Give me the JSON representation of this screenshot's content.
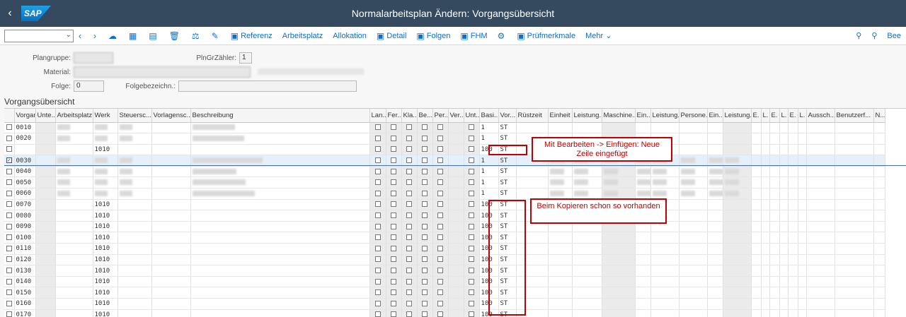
{
  "shell": {
    "back": "‹",
    "logo": "SAP",
    "title": "Normalarbeitsplan Ändern: Vorgangsübersicht"
  },
  "toolbar": {
    "items": [
      {
        "icon": "‹",
        "label": ""
      },
      {
        "icon": "›",
        "label": ""
      },
      {
        "icon": "☁",
        "label": ""
      },
      {
        "icon": "▦",
        "label": ""
      },
      {
        "icon": "▤",
        "label": ""
      },
      {
        "icon": "🗑",
        "label": ""
      },
      {
        "icon": "⚖",
        "label": ""
      },
      {
        "icon": "✎",
        "label": ""
      },
      {
        "icon": "▣",
        "label": "Referenz"
      },
      {
        "icon": "",
        "label": "Arbeitsplatz"
      },
      {
        "icon": "",
        "label": "Allokation"
      },
      {
        "icon": "▣",
        "label": "Detail"
      },
      {
        "icon": "▣",
        "label": "Folgen"
      },
      {
        "icon": "▣",
        "label": "FHM"
      },
      {
        "icon": "⚙",
        "label": ""
      },
      {
        "icon": "▣",
        "label": "Prüfmerkmale"
      },
      {
        "icon": "",
        "label": "Mehr ⌄"
      }
    ],
    "right": {
      "search": "⚲",
      "zoom": "⚲",
      "edit": "Bee"
    }
  },
  "header": {
    "plangruppe_label": "Plangruppe:",
    "plngrzaehler_label": "PlnGrZähler:",
    "plngrzaehler_value": "1",
    "material_label": "Material:",
    "folge_label": "Folge:",
    "folge_value": "0",
    "folgebez_label": "Folgebezeichn.:"
  },
  "section_title": "Vorgangsübersicht",
  "columns": [
    "",
    "Vorgang",
    "Unte...",
    "Arbeitsplatz",
    "Werk",
    "Steuersc...",
    "Vorlagensc...",
    "Beschreibung",
    "Lan...",
    "Fer...",
    "Kla...",
    "Be...",
    "Per...",
    "Ver...",
    "Unt...",
    "Basi...",
    "Vor...",
    "Rüstzeit",
    "Einheit",
    "Leistung...",
    "Maschine...",
    "Ein...",
    "Leistung...",
    "Persone...",
    "Ein...",
    "Leistung...",
    "E.",
    "L.",
    "E.",
    "L.",
    "E.",
    "L.",
    "Aussch...",
    "Benutzerf...",
    "N..."
  ],
  "rows": [
    {
      "vorgang": "0010",
      "werk": "",
      "basis": "1",
      "einheit": "ST",
      "checked": false,
      "blurred": true
    },
    {
      "vorgang": "0020",
      "werk": "",
      "basis": "1",
      "einheit": "ST",
      "checked": false,
      "blurred": true
    },
    {
      "vorgang": "",
      "werk": "1010",
      "basis": "100",
      "einheit": "ST",
      "checked": false,
      "blurred": false
    },
    {
      "vorgang": "0030",
      "werk": "",
      "basis": "1",
      "einheit": "ST",
      "checked": true,
      "blurred": true
    },
    {
      "vorgang": "0040",
      "werk": "",
      "basis": "1",
      "einheit": "ST",
      "checked": false,
      "blurred": true
    },
    {
      "vorgang": "0050",
      "werk": "",
      "basis": "1",
      "einheit": "ST",
      "checked": false,
      "blurred": true
    },
    {
      "vorgang": "0060",
      "werk": "",
      "basis": "1",
      "einheit": "ST",
      "checked": false,
      "blurred": true
    },
    {
      "vorgang": "0070",
      "werk": "1010",
      "basis": "100",
      "einheit": "ST",
      "checked": false,
      "blurred": false
    },
    {
      "vorgang": "0080",
      "werk": "1010",
      "basis": "100",
      "einheit": "ST",
      "checked": false,
      "blurred": false
    },
    {
      "vorgang": "0090",
      "werk": "1010",
      "basis": "100",
      "einheit": "ST",
      "checked": false,
      "blurred": false
    },
    {
      "vorgang": "0100",
      "werk": "1010",
      "basis": "100",
      "einheit": "ST",
      "checked": false,
      "blurred": false
    },
    {
      "vorgang": "0110",
      "werk": "1010",
      "basis": "100",
      "einheit": "ST",
      "checked": false,
      "blurred": false
    },
    {
      "vorgang": "0120",
      "werk": "1010",
      "basis": "100",
      "einheit": "ST",
      "checked": false,
      "blurred": false
    },
    {
      "vorgang": "0130",
      "werk": "1010",
      "basis": "100",
      "einheit": "ST",
      "checked": false,
      "blurred": false
    },
    {
      "vorgang": "0140",
      "werk": "1010",
      "basis": "100",
      "einheit": "ST",
      "checked": false,
      "blurred": false
    },
    {
      "vorgang": "0150",
      "werk": "1010",
      "basis": "100",
      "einheit": "ST",
      "checked": false,
      "blurred": false
    },
    {
      "vorgang": "0160",
      "werk": "1010",
      "basis": "100",
      "einheit": "ST",
      "checked": false,
      "blurred": false
    },
    {
      "vorgang": "0170",
      "werk": "1010",
      "basis": "100",
      "einheit": "ST",
      "checked": false,
      "blurred": false
    }
  ],
  "annotations": {
    "note1": "Mit Bearbeiten -> Einfügen: Neue Zeile eingefügt",
    "note2": "Beim Kopieren schon so vorhanden"
  },
  "colors": {
    "shell": "#354a5f",
    "accent": "#0a6ed1",
    "annotation": "#c00000"
  }
}
